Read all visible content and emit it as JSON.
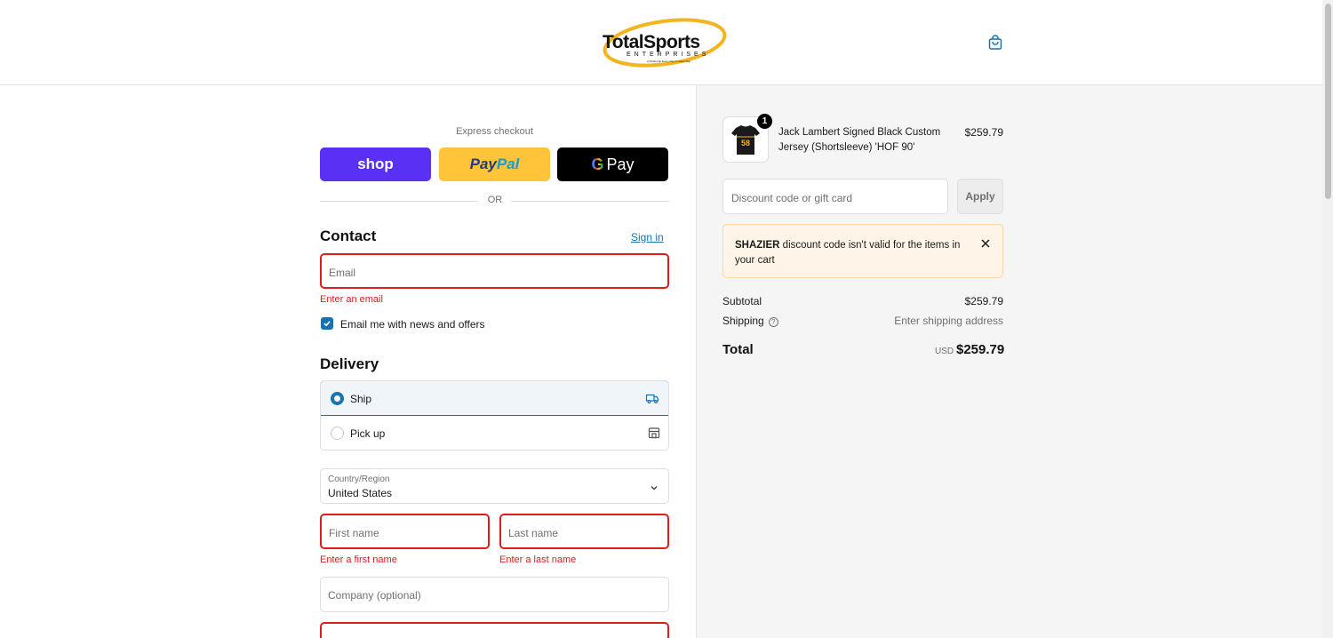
{
  "header": {
    "logo": {
      "main": "TotalSports",
      "sub": "ENTERPRISES",
      "tagline": "A Pittsburgh Every Day is Game Day"
    },
    "cart_icon": "shopping-bag-icon"
  },
  "express": {
    "label": "Express checkout",
    "shop_label": "shop",
    "paypal_label_1": "Pay",
    "paypal_label_2": "Pal",
    "gpay_g": "G",
    "gpay_label": "Pay",
    "or_label": "OR"
  },
  "contact": {
    "title": "Contact",
    "signin": "Sign in",
    "email_placeholder": "Email",
    "email_error": "Enter an email",
    "newsletter_label": "Email me with news and offers",
    "newsletter_checked": true
  },
  "delivery": {
    "title": "Delivery",
    "options": [
      {
        "label": "Ship",
        "selected": true,
        "icon": "truck-icon"
      },
      {
        "label": "Pick up",
        "selected": false,
        "icon": "store-icon"
      }
    ],
    "country_label": "Country/Region",
    "country_value": "United States",
    "first_name_placeholder": "First name",
    "first_name_error": "Enter a first name",
    "last_name_placeholder": "Last name",
    "last_name_error": "Enter a last name",
    "company_placeholder": "Company (optional)"
  },
  "summary": {
    "item": {
      "name": "Jack Lambert Signed Black Custom Jersey (Shortsleeve) 'HOF 90'",
      "price": "$259.79",
      "quantity": "1",
      "jersey_number": "58"
    },
    "discount_placeholder": "Discount code or gift card",
    "apply_label": "Apply",
    "alert": {
      "code": "SHAZIER",
      "message": " discount code isn't valid for the items in your cart"
    },
    "subtotal_label": "Subtotal",
    "subtotal_value": "$259.79",
    "shipping_label": "Shipping",
    "shipping_help": "?",
    "shipping_value": "Enter shipping address",
    "total_label": "Total",
    "total_currency": "USD",
    "total_value": "$259.79"
  },
  "colors": {
    "accent": "#1773b0",
    "error": "#dd1d1d",
    "shop_pay": "#5a31f4",
    "paypal": "#ffc439",
    "logo_swoosh": "#f2b520"
  }
}
